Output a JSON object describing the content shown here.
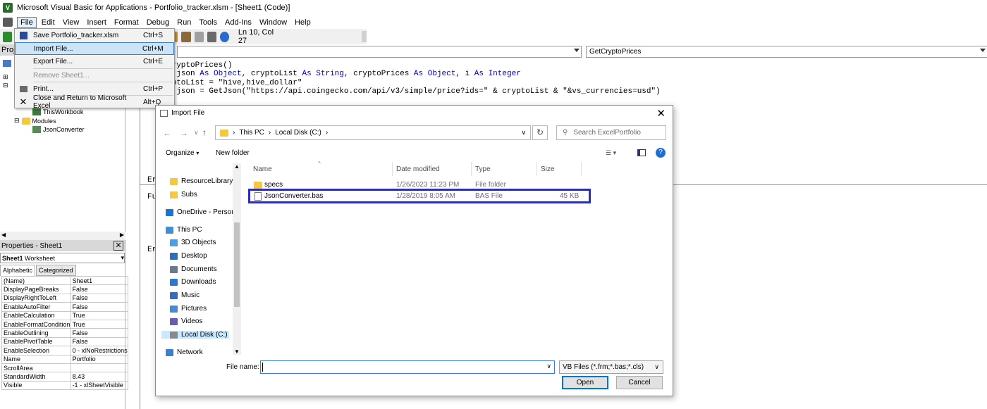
{
  "window": {
    "title": "Microsoft Visual Basic for Applications - Portfolio_tracker.xlsm - [Sheet1 (Code)]"
  },
  "menubar": {
    "items": [
      "File",
      "Edit",
      "View",
      "Insert",
      "Format",
      "Debug",
      "Run",
      "Tools",
      "Add-Ins",
      "Window",
      "Help"
    ],
    "active": "File"
  },
  "toolbar": {
    "position": "Ln 10, Col 27"
  },
  "file_menu": {
    "items": [
      {
        "label": "Save Portfolio_tracker.xlsm",
        "shortcut": "Ctrl+S",
        "icon": "save-icon"
      },
      {
        "label": "Import File...",
        "shortcut": "Ctrl+M",
        "icon": ""
      },
      {
        "label": "Export File...",
        "shortcut": "Ctrl+E",
        "icon": ""
      },
      {
        "label": "Remove Sheet1...",
        "shortcut": "",
        "icon": ""
      },
      {
        "label": "Print...",
        "shortcut": "Ctrl+P",
        "icon": "print-icon"
      },
      {
        "label": "Close and Return to Microsoft Excel",
        "shortcut": "Alt+Q",
        "icon": "close-icon"
      }
    ],
    "highlighted": "Import File..."
  },
  "project": {
    "caption": "Proje",
    "nodes": {
      "thisworkbook": "ThisWorkbook",
      "modules": "Modules",
      "jsonconverter": "JsonConverter"
    }
  },
  "properties": {
    "caption": "Properties - Sheet1",
    "object_name": "Sheet1",
    "object_type": "Worksheet",
    "tabs": [
      "Alphabetic",
      "Categorized"
    ],
    "rows": [
      [
        "(Name)",
        "Sheet1"
      ],
      [
        "DisplayPageBreaks",
        "False"
      ],
      [
        "DisplayRightToLeft",
        "False"
      ],
      [
        "EnableAutoFilter",
        "False"
      ],
      [
        "EnableCalculation",
        "True"
      ],
      [
        "EnableFormatCondition",
        "True"
      ],
      [
        "EnableOutlining",
        "False"
      ],
      [
        "EnablePivotTable",
        "False"
      ],
      [
        "EnableSelection",
        "0 - xlNoRestrictions"
      ],
      [
        "Name",
        "Portfolio"
      ],
      [
        "ScrollArea",
        ""
      ],
      [
        "StandardWidth",
        "8.43"
      ],
      [
        "Visible",
        "-1 - xlSheetVisible"
      ]
    ]
  },
  "code": {
    "procedure": "GetCryptoPrices",
    "lines": [
      {
        "plain": "CryptoPrices()",
        "kw": ""
      },
      {
        "plain": "m json As Object, cryptoList As String, cryptoPrices As Object, i As Integer",
        "kw": ""
      },
      {
        "plain": "yptoList = \"hive,hive_dollar\"",
        "kw": ""
      },
      {
        "plain": "t json = GetJson(\"https://api.coingecko.com/api/v3/simple/price?ids=\" & cryptoList & \"&vs_currencies=usd\")",
        "kw": ""
      }
    ],
    "left_fragments": [
      "Er",
      "Fu",
      "Er"
    ]
  },
  "dialog": {
    "title": "Import File",
    "breadcrumb": [
      "This PC",
      "Local Disk (C:)"
    ],
    "search_placeholder": "Search ExcelPortfolio",
    "organize": "Organize",
    "new_folder": "New folder",
    "nav_items": [
      {
        "label": "ResourceLibrary",
        "icon": "folder-icon"
      },
      {
        "label": "Subs",
        "icon": "folder-icon"
      },
      {
        "label": "OneDrive - Person",
        "icon": "cloud-icon"
      },
      {
        "label": "This PC",
        "icon": "computer-icon"
      },
      {
        "label": "3D Objects",
        "icon": "cube-icon"
      },
      {
        "label": "Desktop",
        "icon": "desktop-icon"
      },
      {
        "label": "Documents",
        "icon": "documents-icon"
      },
      {
        "label": "Downloads",
        "icon": "download-icon"
      },
      {
        "label": "Music",
        "icon": "music-icon"
      },
      {
        "label": "Pictures",
        "icon": "pictures-icon"
      },
      {
        "label": "Videos",
        "icon": "videos-icon"
      },
      {
        "label": "Local Disk (C:)",
        "icon": "disk-icon"
      },
      {
        "label": "Network",
        "icon": "network-icon"
      }
    ],
    "columns": [
      "Name",
      "Date modified",
      "Type",
      "Size"
    ],
    "files": [
      {
        "name": "specs",
        "date": "1/26/2023 11:23 PM",
        "type": "File folder",
        "size": "",
        "icon": "folder-icon"
      },
      {
        "name": "JsonConverter.bas",
        "date": "1/28/2019 8:05 AM",
        "type": "BAS File",
        "size": "45 KB",
        "icon": "file-icon"
      }
    ],
    "file_name_label": "File name:",
    "file_name_value": "",
    "file_type": "VB Files (*.frm;*.bas;*.cls)",
    "open_label": "Open",
    "cancel_label": "Cancel"
  }
}
